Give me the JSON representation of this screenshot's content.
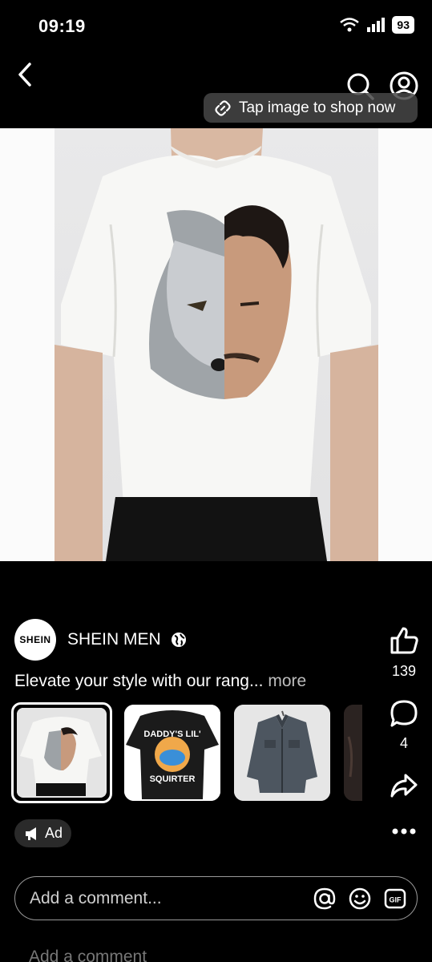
{
  "status": {
    "time": "09:19",
    "battery": "93"
  },
  "header": {
    "tap_hint": "Tap image to shop now"
  },
  "brand": {
    "logo_text": "SHEIN",
    "name": "SHEIN MEN"
  },
  "caption": {
    "text": "Elevate your style with our rang...",
    "more_label": "more"
  },
  "actions": {
    "likes": "139",
    "comments": "4"
  },
  "thumbnails": [
    {
      "name": "wolf-face-tshirt",
      "selected": true
    },
    {
      "name": "daddys-lil-squirter-tshirt",
      "text1": "DADDY'S LIL'",
      "text2": "SQUIRTER"
    },
    {
      "name": "denim-jacket"
    },
    {
      "name": "partial-product"
    }
  ],
  "ad": {
    "label": "Ad"
  },
  "comment": {
    "placeholder": "Add a comment...",
    "ghost": "Add a comment"
  },
  "colors": {
    "background": "#000000",
    "pill": "#464646",
    "ad_badge": "#2a2a2a"
  }
}
